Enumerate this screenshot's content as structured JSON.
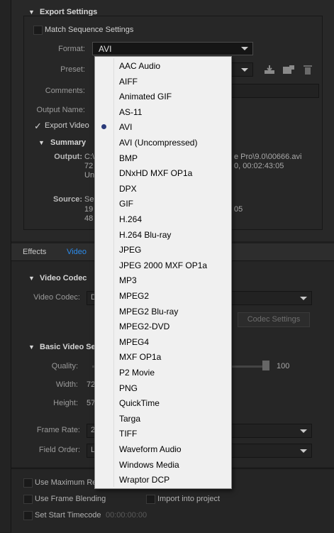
{
  "export_settings": {
    "title": "Export Settings",
    "match_sequence_label": "Match Sequence Settings",
    "format_label": "Format:",
    "format_value": "AVI",
    "preset_label": "Preset:",
    "comments_label": "Comments:",
    "output_name_label": "Output Name:",
    "export_video_label": "Export Video",
    "summary_title": "Summary",
    "output_label": "Output:",
    "output_line1_left": "C:\\",
    "output_line1_right": "e Pro\\9.0\\00666.avi",
    "output_line2_left": "72",
    "output_line2_right": "0, 00:02:43:05",
    "output_line3_left": "Un",
    "source_label": "Source:",
    "source_line1_left": "Se",
    "source_line2_left": "19",
    "source_line2_right": "05",
    "source_line3_left": "48"
  },
  "tabs": {
    "effects": "Effects",
    "video": "Video"
  },
  "video_codec": {
    "title": "Video Codec",
    "label": "Video Codec:",
    "value_partial": "D",
    "codec_settings_button": "Codec Settings"
  },
  "basic_video": {
    "title": "Basic Video Se",
    "quality_label": "Quality:",
    "quality_value": "100",
    "width_label": "Width:",
    "width_value": "72",
    "height_label": "Height:",
    "height_value": "57",
    "frame_rate_label": "Frame Rate:",
    "frame_rate_value": "2",
    "field_order_label": "Field Order:",
    "field_order_value": "L"
  },
  "bottom": {
    "use_max_render": "Use Maximum Re",
    "use_frame_blending": "Use Frame Blending",
    "import_into_project": "Import into project",
    "set_start_timecode": "Set Start Timecode",
    "timecode_value": "00:00:00:00"
  },
  "format_dropdown": {
    "selected": "AVI",
    "options": [
      "AAC Audio",
      "AIFF",
      "Animated GIF",
      "AS-11",
      "AVI",
      "AVI (Uncompressed)",
      "BMP",
      "DNxHD MXF OP1a",
      "DPX",
      "GIF",
      "H.264",
      "H.264 Blu-ray",
      "JPEG",
      "JPEG 2000 MXF OP1a",
      "MP3",
      "MPEG2",
      "MPEG2 Blu-ray",
      "MPEG2-DVD",
      "MPEG4",
      "MXF OP1a",
      "P2 Movie",
      "PNG",
      "QuickTime",
      "Targa",
      "TIFF",
      "Waveform Audio",
      "Windows Media",
      "Wraptor DCP"
    ]
  },
  "icons": {
    "save_preset": "save-preset-icon",
    "import_preset": "import-preset-icon",
    "delete_preset": "trash-icon",
    "check": "✓"
  }
}
